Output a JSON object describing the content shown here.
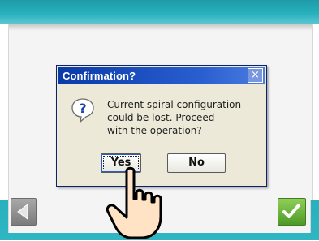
{
  "dialog": {
    "title": "Confirmation?",
    "close_symbol": "×",
    "message_lines": [
      "Current spiral configuration",
      "could be lost. Proceed",
      "with the operation?"
    ],
    "yes_label": "Yes",
    "no_label": "No"
  },
  "icons": {
    "question": "question-icon",
    "back": "back-arrow-icon",
    "confirm": "checkmark-icon",
    "hand": "pointing-hand-icon",
    "close": "close-icon"
  },
  "colors": {
    "accent": "#27b0bd",
    "titlebar": "#0a3aa8",
    "confirm_green": "#4e9a27"
  }
}
